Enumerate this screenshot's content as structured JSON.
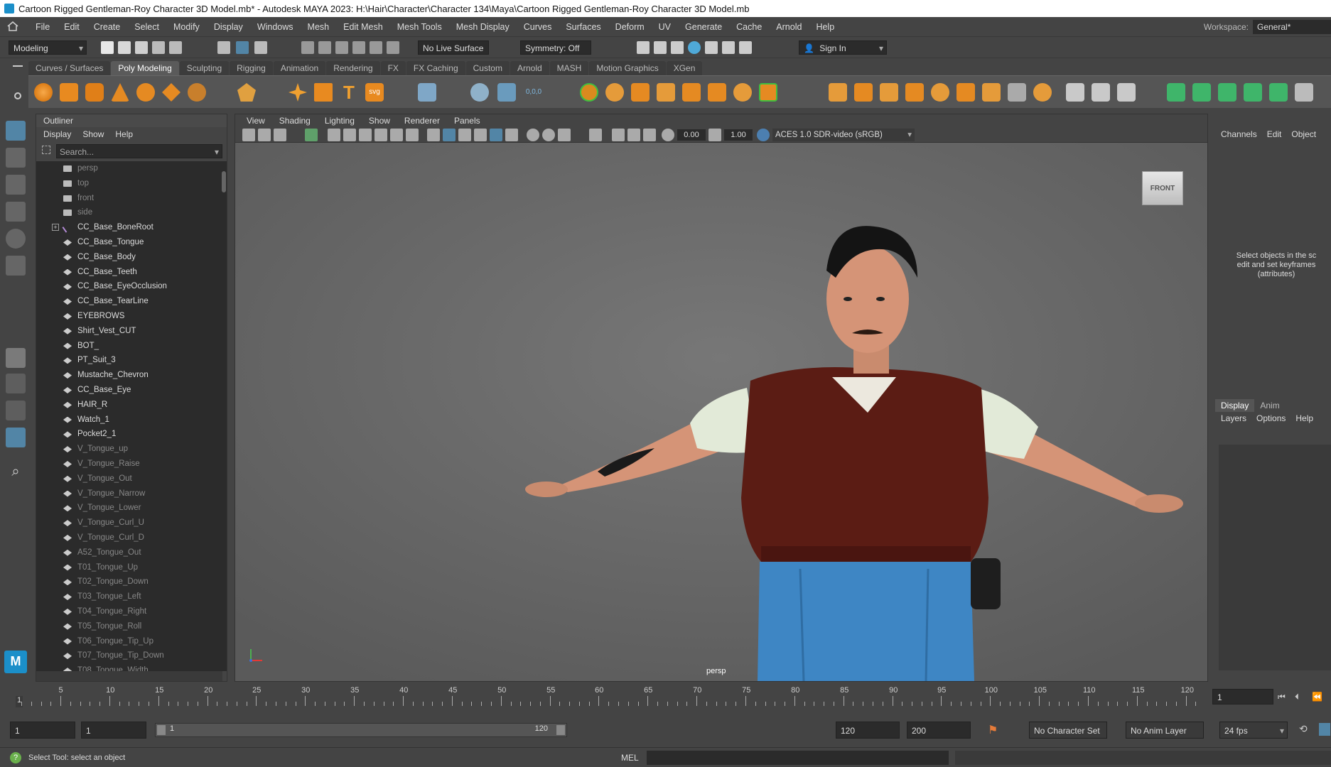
{
  "title_bar": {
    "text": "Cartoon Rigged Gentleman-Roy Character 3D Model.mb* - Autodesk MAYA 2023: H:\\Hair\\Character\\Character 134\\Maya\\Cartoon Rigged Gentleman-Roy Character 3D Model.mb"
  },
  "menubar": {
    "items": [
      "File",
      "Edit",
      "Create",
      "Select",
      "Modify",
      "Display",
      "Windows",
      "Mesh",
      "Edit Mesh",
      "Mesh Tools",
      "Mesh Display",
      "Curves",
      "Surfaces",
      "Deform",
      "UV",
      "Generate",
      "Cache",
      "Arnold",
      "Help"
    ],
    "workspace_label": "Workspace:",
    "workspace_value": "General*"
  },
  "statusline": {
    "mode": "Modeling",
    "live_surface": "No Live Surface",
    "symmetry": "Symmetry: Off",
    "sign_in": "Sign In"
  },
  "shelf": {
    "tabs": [
      "Curves / Surfaces",
      "Poly Modeling",
      "Sculpting",
      "Rigging",
      "Animation",
      "Rendering",
      "FX",
      "FX Caching",
      "Custom",
      "Arnold",
      "MASH",
      "Motion Graphics",
      "XGen"
    ],
    "active_tab": "Poly Modeling",
    "coord_label": "0,0,0"
  },
  "outliner": {
    "title": "Outliner",
    "menu": [
      "Display",
      "Show",
      "Help"
    ],
    "search_placeholder": "Search...",
    "items": [
      {
        "label": "persp",
        "dim": true,
        "type": "camera"
      },
      {
        "label": "top",
        "dim": true,
        "type": "camera"
      },
      {
        "label": "front",
        "dim": true,
        "type": "camera"
      },
      {
        "label": "side",
        "dim": true,
        "type": "camera"
      },
      {
        "label": "CC_Base_BoneRoot",
        "dim": false,
        "type": "joint"
      },
      {
        "label": "CC_Base_Tongue",
        "dim": false,
        "type": "mesh"
      },
      {
        "label": "CC_Base_Body",
        "dim": false,
        "type": "mesh"
      },
      {
        "label": "CC_Base_Teeth",
        "dim": false,
        "type": "mesh"
      },
      {
        "label": "CC_Base_EyeOcclusion",
        "dim": false,
        "type": "mesh"
      },
      {
        "label": "CC_Base_TearLine",
        "dim": false,
        "type": "mesh"
      },
      {
        "label": "EYEBROWS",
        "dim": false,
        "type": "mesh"
      },
      {
        "label": "Shirt_Vest_CUT",
        "dim": false,
        "type": "mesh"
      },
      {
        "label": "BOT_",
        "dim": false,
        "type": "mesh"
      },
      {
        "label": "PT_Suit_3",
        "dim": false,
        "type": "mesh"
      },
      {
        "label": "Mustache_Chevron",
        "dim": false,
        "type": "mesh"
      },
      {
        "label": "CC_Base_Eye",
        "dim": false,
        "type": "mesh"
      },
      {
        "label": "HAIR_R",
        "dim": false,
        "type": "mesh"
      },
      {
        "label": "Watch_1",
        "dim": false,
        "type": "mesh"
      },
      {
        "label": "Pocket2_1",
        "dim": false,
        "type": "mesh"
      },
      {
        "label": "V_Tongue_up",
        "dim": true,
        "type": "mesh"
      },
      {
        "label": "V_Tongue_Raise",
        "dim": true,
        "type": "mesh"
      },
      {
        "label": "V_Tongue_Out",
        "dim": true,
        "type": "mesh"
      },
      {
        "label": "V_Tongue_Narrow",
        "dim": true,
        "type": "mesh"
      },
      {
        "label": "V_Tongue_Lower",
        "dim": true,
        "type": "mesh"
      },
      {
        "label": "V_Tongue_Curl_U",
        "dim": true,
        "type": "mesh"
      },
      {
        "label": "V_Tongue_Curl_D",
        "dim": true,
        "type": "mesh"
      },
      {
        "label": "A52_Tongue_Out",
        "dim": true,
        "type": "mesh"
      },
      {
        "label": "T01_Tongue_Up",
        "dim": true,
        "type": "mesh"
      },
      {
        "label": "T02_Tongue_Down",
        "dim": true,
        "type": "mesh"
      },
      {
        "label": "T03_Tongue_Left",
        "dim": true,
        "type": "mesh"
      },
      {
        "label": "T04_Tongue_Right",
        "dim": true,
        "type": "mesh"
      },
      {
        "label": "T05_Tongue_Roll",
        "dim": true,
        "type": "mesh"
      },
      {
        "label": "T06_Tongue_Tip_Up",
        "dim": true,
        "type": "mesh"
      },
      {
        "label": "T07_Tongue_Tip_Down",
        "dim": true,
        "type": "mesh"
      },
      {
        "label": "T08_Tongue_Width",
        "dim": true,
        "type": "mesh"
      }
    ]
  },
  "viewport": {
    "menu": [
      "View",
      "Shading",
      "Lighting",
      "Show",
      "Renderer",
      "Panels"
    ],
    "exposure": "0.00",
    "gamma": "1.00",
    "color_space": "ACES 1.0 SDR-video (sRGB)",
    "view_cube_label": "FRONT",
    "camera_label": "persp"
  },
  "channel_box": {
    "menu": [
      "Channels",
      "Edit",
      "Object"
    ],
    "hint_lines": [
      "Select objects in the sc",
      "edit and set keyframes",
      "(attributes)"
    ],
    "layer_tabs": [
      "Display",
      "Anim"
    ],
    "layer_menu": [
      "Layers",
      "Options",
      "Help"
    ]
  },
  "timeline": {
    "ticks": [
      "5",
      "10",
      "15",
      "20",
      "25",
      "30",
      "35",
      "40",
      "45",
      "50",
      "55",
      "60",
      "65",
      "70",
      "75",
      "80",
      "85",
      "90",
      "95",
      "100",
      "105",
      "110",
      "115",
      "120"
    ],
    "current_frame_marker": "1",
    "current_frame_field": "1"
  },
  "range": {
    "start": "1",
    "anim_start": "1",
    "slider_start": "1",
    "slider_end": "120",
    "end": "120",
    "anim_end": "200",
    "character_set": "No Character Set",
    "anim_layer": "No Anim Layer",
    "fps": "24 fps"
  },
  "helpline": {
    "message": "Select Tool: select an object",
    "mel_label": "MEL"
  },
  "colors": {
    "accent": "#5285a6",
    "panel": "#444444",
    "field": "#2b2b2b",
    "viewport_bg": "#707070"
  }
}
